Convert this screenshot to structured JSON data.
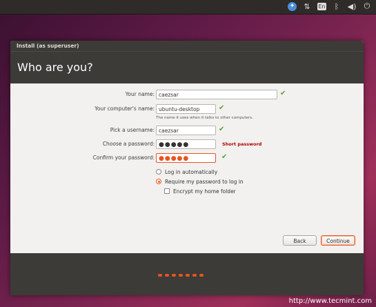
{
  "window": {
    "title": "Install (as superuser)",
    "heading": "Who are you?"
  },
  "form": {
    "name_label": "Your name:",
    "name_value": "caezsar",
    "computer_label": "Your computer's name:",
    "computer_value": "ubuntu-desktop",
    "computer_hint": "The name it uses when it talks to other computers.",
    "username_label": "Pick a username:",
    "username_value": "caezsar",
    "password_label": "Choose a password:",
    "password_value": "●●●●●",
    "password_warning": "Short password",
    "confirm_label": "Confirm your password:",
    "confirm_value": "●●●●●"
  },
  "options": {
    "login_auto": "Log in automatically",
    "require_password": "Require my password to log in",
    "encrypt_home": "Encrypt my home folder",
    "selected": "require_password"
  },
  "buttons": {
    "back": "Back",
    "continue": "Continue"
  },
  "progress": {
    "steps": 7
  },
  "panel": {
    "keyboard": "En"
  },
  "watermark": "http://www.tecmint.com",
  "colors": {
    "accent": "#e95420",
    "check": "#5aa02c",
    "warning": "#b30000",
    "dark": "#3c3b37"
  }
}
